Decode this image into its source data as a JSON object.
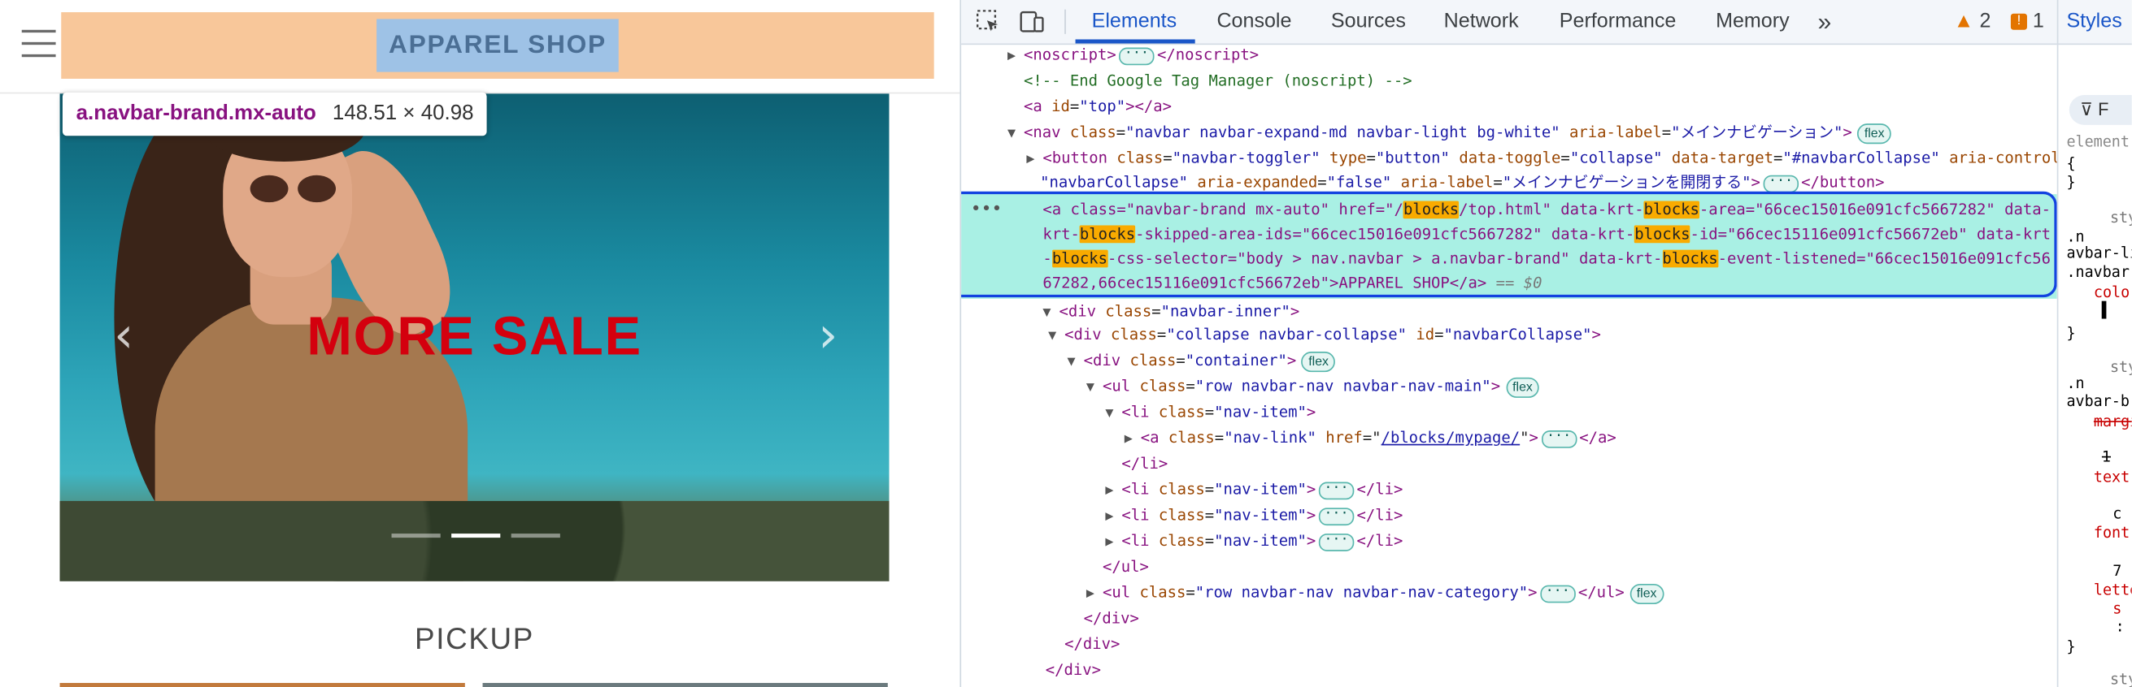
{
  "site": {
    "brand": "APPAREL SHOP",
    "tooltip_selector": "a.navbar-brand.mx-auto",
    "tooltip_size": "148.51 × 40.98",
    "hero_title": "MORE SALE",
    "prev_arrow": "‹",
    "next_arrow": "›",
    "section_title": "PICKUP"
  },
  "devtools": {
    "tabs": [
      "Elements",
      "Console",
      "Sources",
      "Network",
      "Performance",
      "Memory"
    ],
    "more_tabs": "»",
    "warnings_count": "2",
    "errors_count": "1",
    "styles_tab": "Styles",
    "filter_placeholder": "F",
    "dom_lines": {
      "l1_tag": "<noscript>",
      "l1_end": "</noscript>",
      "l2": "<!-- End Google Tag Manager (noscript) -->",
      "l3_tag": "<a ",
      "l3_attr": "id",
      "l3_val": "\"top\"",
      "l3_end": "></a>",
      "l4_tag": "<nav ",
      "l4_attr1": "class",
      "l4_val1": "\"navbar navbar-expand-md navbar-light bg-white\"",
      "l4_attr2": "aria-label",
      "l4_val2": "\"メインナビゲーション\"",
      "l4_end": ">",
      "flex": "flex",
      "l5_tag": "<button ",
      "l5_attr1": "class",
      "l5_val1": "\"navbar-toggler\"",
      "l5_attr2": "type",
      "l5_val2": "\"button\"",
      "l5_attr3": "data-toggle",
      "l5_val3": "\"collapse\"",
      "l5_attr4": "data-target",
      "l5_val4": "\"#navbarCollapse\"",
      "l5_attr5": "aria-controls",
      "l5b_val5": "\"navbarCollapse\"",
      "l5b_attr6": "aria-expanded",
      "l5b_val6": "\"false\"",
      "l5b_attr7": "aria-label",
      "l5b_val7": "\"メインナビゲーションを開閉する\"",
      "l5b_end": "</button>",
      "selected_html_1": "<a class=\"navbar-brand mx-auto\" href=\"/",
      "selected_hl": "blocks",
      "selected_html_2": "/top.html\" data-krt-",
      "selected_html_3": "-area=\"66cec15016e091cfc5667282\" data-krt-",
      "selected_html_4": "-skipped-area-ids=\"66cec15016e091cfc5667282\" data-krt-",
      "selected_html_5": "-id=\"66cec15116e091cfc56672eb\" data-krt-",
      "selected_html_6": "-css-selector=\"body > nav.navbar > a.navbar-brand\" data-krt-",
      "selected_html_7": "-event-listened=\"66cec15016e091cfc5667282,66cec15116e091cfc56672eb\">APPAREL SHOP</a>",
      "selected_eq": "== $0",
      "l7_tag": "<div ",
      "l7_attr": "class",
      "l7_val": "\"navbar-inner\"",
      "l7_end": ">",
      "l8_tag": "<div ",
      "l8_attr1": "class",
      "l8_val1": "\"collapse navbar-collapse\"",
      "l8_attr2": "id",
      "l8_val2": "\"navbarCollapse\"",
      "l8_end": ">",
      "l9_tag": "<div ",
      "l9_attr": "class",
      "l9_val": "\"container\"",
      "l9_end": ">",
      "l10_tag": "<ul ",
      "l10_attr": "class",
      "l10_val": "\"row navbar-nav navbar-nav-main\"",
      "l10_end": ">",
      "l11_tag": "<li ",
      "l11_attr": "class",
      "l11_val": "\"nav-item\"",
      "l11_end": ">",
      "l12_tag": "<a ",
      "l12_attr1": "class",
      "l12_val1": "\"nav-link\"",
      "l12_attr2": "href",
      "l12_val2": "/blocks/mypage/",
      "l12_end": "</a>",
      "l13": "</li>",
      "li_tag": "<li ",
      "li_attr": "class",
      "li_val": "\"nav-item\"",
      "li_end": "</li>",
      "l17": "</ul>",
      "l18_tag": "<ul ",
      "l18_attr": "class",
      "l18_val": "\"row navbar-nav navbar-nav-category\"",
      "l18_end": "</ul>",
      "l19": "</div>",
      "l20": "</div>",
      "l21": "</div>"
    }
  }
}
